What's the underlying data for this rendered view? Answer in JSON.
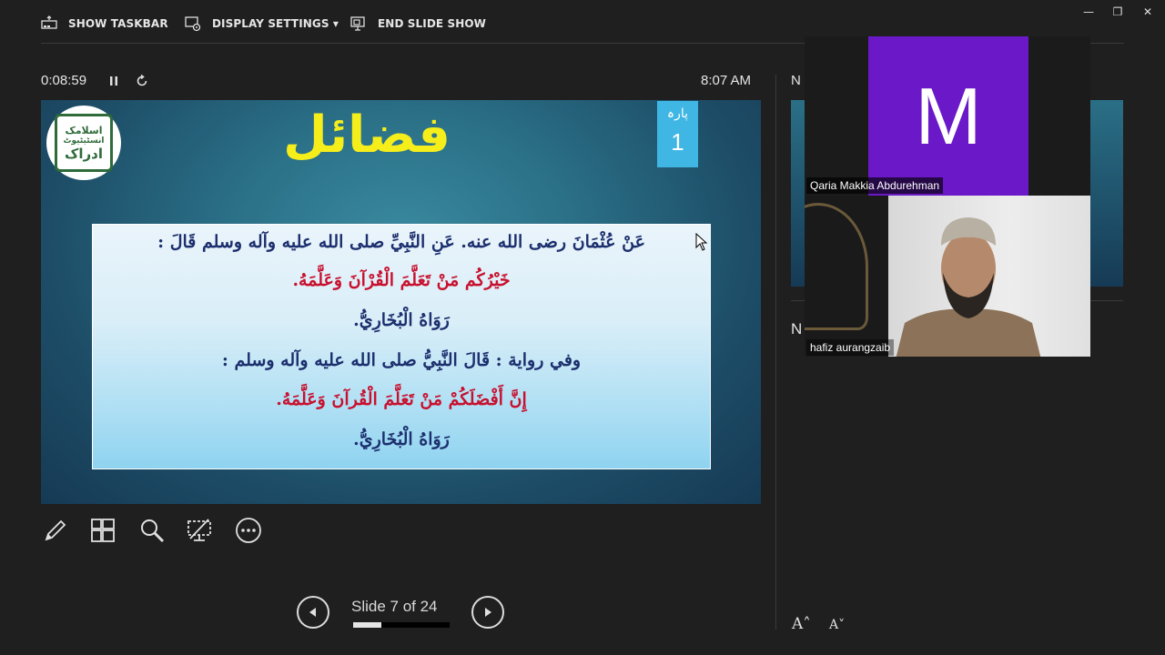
{
  "toolbar": {
    "show_taskbar": "SHOW TASKBAR",
    "display_settings": "DISPLAY SETTINGS ▾",
    "end_slide_show": "END SLIDE SHOW"
  },
  "window_controls": {
    "minimize": "—",
    "restore": "❐",
    "close": "✕"
  },
  "presenter": {
    "elapsed": "0:08:59",
    "clock": "8:07 AM",
    "next_label": "N",
    "notes_label": "N"
  },
  "slide": {
    "title": "فضائل",
    "para_label": "پارہ",
    "para_number": "1",
    "logo_line1": "اسلامک",
    "logo_line2": "انسٹیٹیوٹ",
    "logo_line3": "ادراک",
    "lines": [
      {
        "text": "عَنْ عُثْمَانَ رضی الله عنه. عَنِ النَّبِيِّ صلى الله عليه وآله وسلم قَالَ :",
        "color": "#1c2f6e"
      },
      {
        "text": "خَيْرُكُم مَنْ تَعَلَّمَ الْقُرْآنَ وَعَلَّمَهُ.",
        "color": "#c8102e"
      },
      {
        "text": "رَوَاهُ الْبُخَارِيُّ.",
        "color": "#1c2f6e"
      },
      {
        "text": "وفي رواية : قَالَ النَّبِيُّ صلى الله عليه وآله وسلم :",
        "color": "#1c2f6e"
      },
      {
        "text": "إِنَّ أَفْضَلَكُمْ مَنْ تَعَلَّمَ الْقُرآنَ وَعَلَّمَهُ.",
        "color": "#c8102e"
      },
      {
        "text": "رَوَاهُ الْبُخَارِيُّ.",
        "color": "#1c2f6e"
      }
    ]
  },
  "navigation": {
    "slide_counter": "Slide 7 of 24",
    "progress": 0.29
  },
  "participants": {
    "first": {
      "initial": "M",
      "name": "Qaria Makkia Abdurehman",
      "color": "#6a18c8"
    },
    "second": {
      "name": "hafiz aurangzaib"
    }
  },
  "tools": [
    "pen-icon",
    "slide-grid-icon",
    "zoom-icon",
    "screen-icon",
    "more-icon"
  ]
}
